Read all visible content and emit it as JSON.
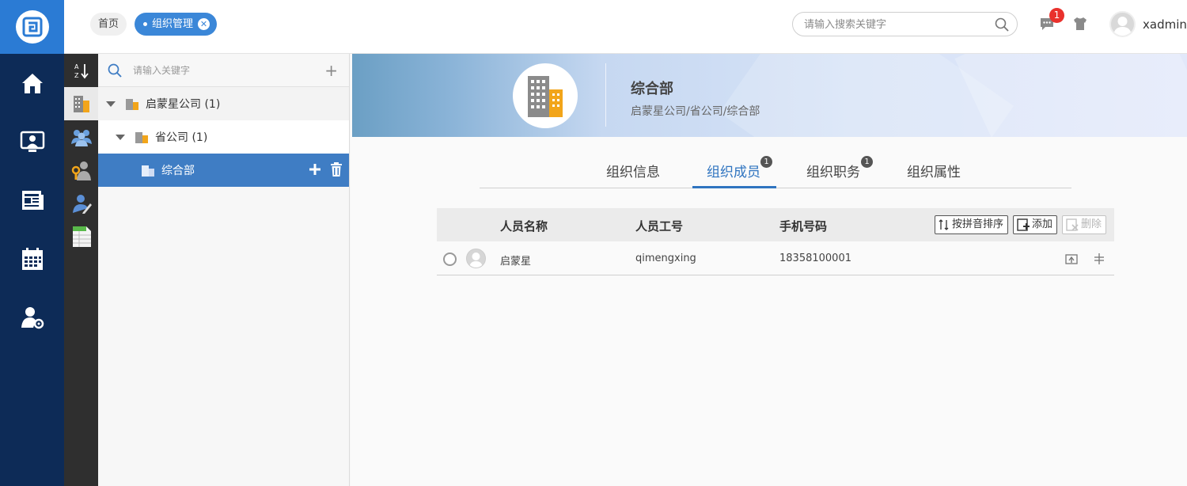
{
  "topbar": {
    "tabs": [
      {
        "label": "首页"
      },
      {
        "label": "组织管理"
      }
    ],
    "search_placeholder": "请输入搜索关键字",
    "message_count": "1",
    "username": "xadmin"
  },
  "tree": {
    "search_placeholder": "请输入关键字",
    "nodes": [
      {
        "label": "启蒙星公司 (1)"
      },
      {
        "label": "省公司 (1)"
      },
      {
        "label": "综合部"
      }
    ]
  },
  "org": {
    "name": "综合部",
    "path": "启蒙星公司/省公司/综合部"
  },
  "subtabs": [
    {
      "label": "组织信息"
    },
    {
      "label": "组织成员",
      "badge": "1"
    },
    {
      "label": "组织职务",
      "badge": "1"
    },
    {
      "label": "组织属性"
    }
  ],
  "members": {
    "columns": [
      "人员名称",
      "人员工号",
      "手机号码"
    ],
    "buttons": {
      "sort": "按拼音排序",
      "add": "添加",
      "delete": "删除"
    },
    "rows": [
      {
        "name": "启蒙星",
        "code": "qimengxing",
        "phone": "18358100001"
      }
    ]
  },
  "colors": {
    "nav_bg": "#0d2b57",
    "accent": "#3b87d8",
    "selected_node": "#3f7dc4",
    "badge_red": "#e9312c"
  }
}
